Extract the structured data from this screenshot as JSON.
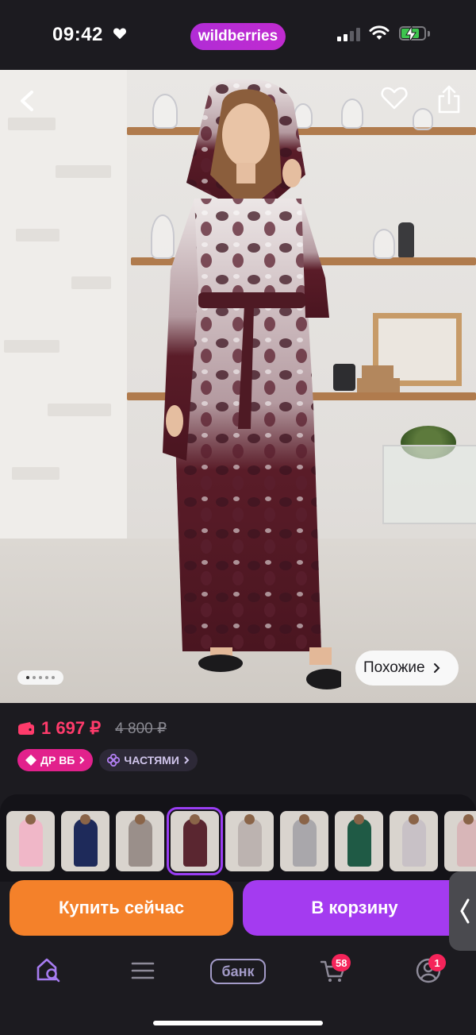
{
  "status_bar": {
    "time": "09:42",
    "brand": "wildberries"
  },
  "hero": {
    "similar_label": "Похожие",
    "dots_total": 5,
    "dots_active": 1
  },
  "price": {
    "current": "1 697 ₽",
    "old": "4 800 ₽"
  },
  "badges": {
    "dr": "ДР ВБ",
    "installments": "ЧАСТЯМИ"
  },
  "thumbnails": [
    {
      "color": "#f0b7c8"
    },
    {
      "color": "#1e2a5a"
    },
    {
      "color": "#9a8f8a"
    },
    {
      "color": "#5a2630",
      "selected": true
    },
    {
      "color": "#bcb3b0"
    },
    {
      "color": "#a9a7ab"
    },
    {
      "color": "#1f5a45"
    },
    {
      "color": "#c8c1c6"
    },
    {
      "color": "#d8b6b8"
    }
  ],
  "actions": {
    "buy_now": "Купить сейчас",
    "add_to_cart": "В корзину"
  },
  "nav": {
    "bank_label": "банк",
    "cart_count": "58",
    "profile_count": "1"
  },
  "colors": {
    "accent": "#a43bf0",
    "price": "#ff3b6b",
    "buy": "#f4812a"
  }
}
